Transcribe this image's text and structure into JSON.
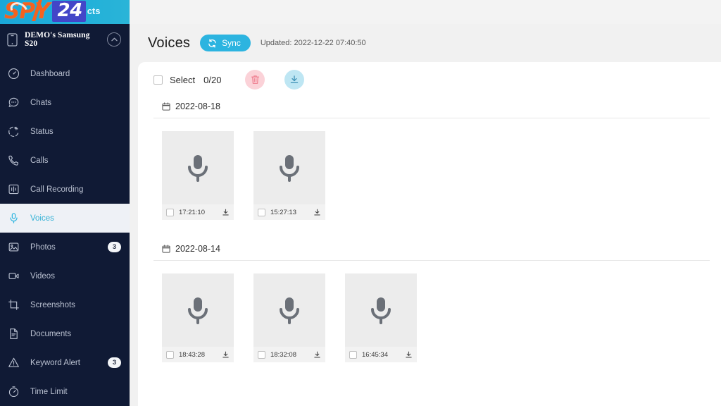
{
  "brand": {
    "spy": "SPY",
    "number": "24",
    "suffix": "cts"
  },
  "sidebar": {
    "device": {
      "name": "DEMO's Samsung S20",
      "device_icon": "phone-icon",
      "collapse_icon": "chevron-up-circle-icon"
    },
    "items": [
      {
        "label": "Dashboard",
        "icon": "speedometer-icon",
        "badge": "",
        "active": false
      },
      {
        "label": "Chats",
        "icon": "chat-bubble-icon",
        "badge": "",
        "active": false
      },
      {
        "label": "Status",
        "icon": "status-plus-icon",
        "badge": "",
        "active": false
      },
      {
        "label": "Calls",
        "icon": "phone-call-icon",
        "badge": "",
        "active": false
      },
      {
        "label": "Call Recording",
        "icon": "waveform-icon",
        "badge": "",
        "active": false
      },
      {
        "label": "Voices",
        "icon": "microphone-icon",
        "badge": "",
        "active": true
      },
      {
        "label": "Photos",
        "icon": "image-icon",
        "badge": "3",
        "active": false
      },
      {
        "label": "Videos",
        "icon": "video-camera-icon",
        "badge": "",
        "active": false
      },
      {
        "label": "Screenshots",
        "icon": "crop-icon",
        "badge": "",
        "active": false
      },
      {
        "label": "Documents",
        "icon": "document-icon",
        "badge": "",
        "active": false
      },
      {
        "label": "Keyword Alert",
        "icon": "warning-triangle-icon",
        "badge": "3",
        "active": false
      },
      {
        "label": "Time Limit",
        "icon": "stopwatch-icon",
        "badge": "",
        "active": false
      }
    ]
  },
  "header": {
    "title": "Voices",
    "sync_label": "Sync",
    "sync_icon": "refresh-icon",
    "updated": "Updated: 2022-12-22 07:40:50"
  },
  "toolbar": {
    "select_label": "Select",
    "select_count": "0/20",
    "delete_icon": "trash-icon",
    "download_icon": "download-icon"
  },
  "groups": [
    {
      "date": "2022-08-18",
      "date_icon": "calendar-icon",
      "items": [
        {
          "time": "17:21:10",
          "thumb_icon": "microphone-icon",
          "download_icon": "download-icon"
        },
        {
          "time": "15:27:13",
          "thumb_icon": "microphone-icon",
          "download_icon": "download-icon"
        }
      ]
    },
    {
      "date": "2022-08-14",
      "date_icon": "calendar-icon",
      "items": [
        {
          "time": "18:43:28",
          "thumb_icon": "microphone-icon",
          "download_icon": "download-icon"
        },
        {
          "time": "18:32:08",
          "thumb_icon": "microphone-icon",
          "download_icon": "download-icon"
        },
        {
          "time": "16:45:34",
          "thumb_icon": "microphone-icon",
          "download_icon": "download-icon"
        }
      ]
    }
  ],
  "colors": {
    "sidebar_bg": "#101a35",
    "brand_orange": "#f4621f",
    "brand_badge": "#4346c8",
    "accent_cyan": "#2cb4e0",
    "active_nav_bg": "#eef1f6",
    "delete_bg": "#fbd2d8",
    "download_bg": "#bee6f3",
    "thumb_bg": "#ececec"
  }
}
